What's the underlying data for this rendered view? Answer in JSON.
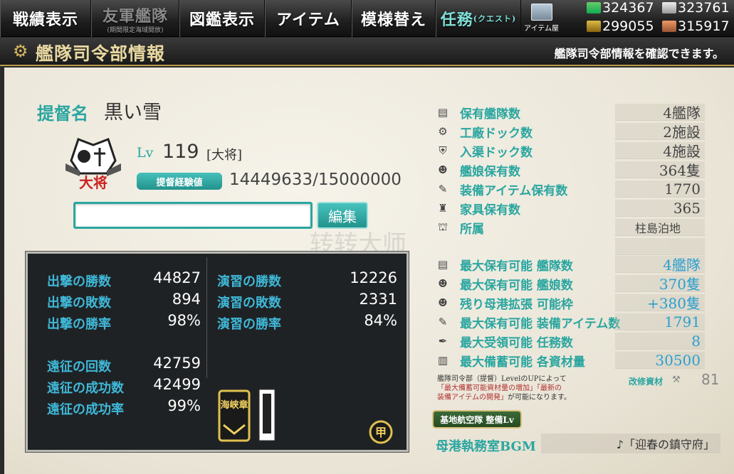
{
  "nav": {
    "tabs": [
      {
        "label": "戦績表示",
        "sub": ""
      },
      {
        "label": "友軍艦隊",
        "sub": "(期間限定海域開放)"
      },
      {
        "label": "図鑑表示",
        "sub": ""
      },
      {
        "label": "アイテム",
        "sub": ""
      },
      {
        "label": "模様替え",
        "sub": ""
      },
      {
        "label": "任務",
        "sub": "(クエスト)"
      }
    ],
    "shop_label": "アイテム屋"
  },
  "resources": {
    "fuel": "324367",
    "steel": "323761",
    "ammo": "299055",
    "bauxite": "315917"
  },
  "title": {
    "text": "艦隊司令部情報",
    "subtitle": "艦隊司令部情報を確認できます。"
  },
  "admiral": {
    "label": "提督名",
    "name": "黒い雪",
    "rank_emblem_text": "大将",
    "lv_label": "Lv",
    "level": "119",
    "rank": "[大将]",
    "exp_label": "提督経験値",
    "exp": "14449633/15000000",
    "comment_value": "",
    "edit_label": "編集"
  },
  "watermark": "转转大师",
  "stats": {
    "sortie": [
      {
        "label": "出撃の勝数",
        "value": "44827"
      },
      {
        "label": "出撃の敗数",
        "value": "894"
      },
      {
        "label": "出撃の勝率",
        "value": "98%"
      }
    ],
    "practice": [
      {
        "label": "演習の勝数",
        "value": "12226"
      },
      {
        "label": "演習の敗数",
        "value": "2331"
      },
      {
        "label": "演習の勝率",
        "value": "84%"
      }
    ],
    "expedition": [
      {
        "label": "遠征の回数",
        "value": "42759"
      },
      {
        "label": "遠征の成功数",
        "value": "42499"
      },
      {
        "label": "遠征の成功率",
        "value": "99%"
      }
    ],
    "medal_a_text": "海峡章",
    "medal_b_text": "甲"
  },
  "info": [
    {
      "icon": "fleet-icon",
      "label": "保有艦隊数",
      "value": "4艦隊"
    },
    {
      "icon": "gear-icon",
      "label": "工廠ドック数",
      "value": "2施設"
    },
    {
      "icon": "repair-icon",
      "label": "入渠ドック数",
      "value": "4施設"
    },
    {
      "icon": "shipgirl-icon",
      "label": "艦娘保有数",
      "value": "364隻"
    },
    {
      "icon": "equipment-icon",
      "label": "装備アイテム保有数",
      "value": "1770"
    },
    {
      "icon": "furniture-icon",
      "label": "家具保有数",
      "value": "365"
    },
    {
      "icon": "base-icon",
      "label": "所属",
      "value": "柱島泊地"
    }
  ],
  "max": [
    {
      "icon": "fleet-icon",
      "label": "最大保有可能 艦隊数",
      "value": "4艦隊"
    },
    {
      "icon": "shipgirl-icon",
      "label": "最大保有可能 艦娘数",
      "value": "370隻"
    },
    {
      "icon": "shipgirl-icon",
      "label": "残り母港拡張 可能枠",
      "value": "+380隻"
    },
    {
      "icon": "equipment-icon",
      "label": "最大保有可能 装備アイテム数",
      "value": "1791"
    },
    {
      "icon": "feather-icon",
      "label": "最大受領可能 任務数",
      "value": "8"
    },
    {
      "icon": "book-icon",
      "label": "最大備蓄可能 各資材量",
      "value": "30500"
    }
  ],
  "lvup_note": {
    "line1": "艦隊司令部（提督）LevelのUPによって",
    "line2": "「最大備蓄可能資材量の増加」「最新の",
    "line3": "装備アイテムの開発」",
    "line3b": "が可能になります。"
  },
  "material": {
    "label": "改修資材",
    "value": "81"
  },
  "airbase_button": "基地航空隊 整備Lv",
  "bgm": {
    "label": "母港執務室BGM",
    "value": "♪「迎春の鎮守府」"
  }
}
